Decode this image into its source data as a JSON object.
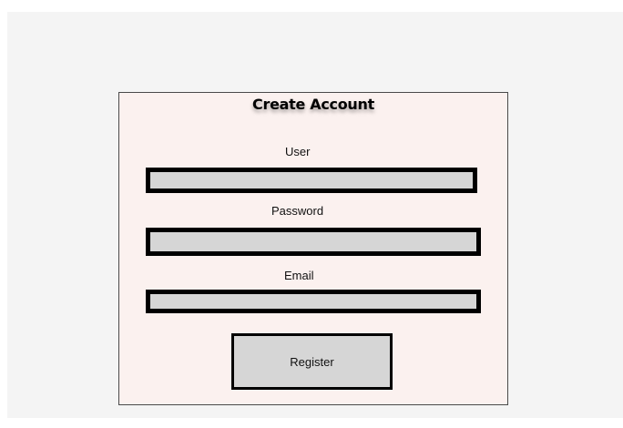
{
  "form": {
    "title": "Create Account",
    "user_label": "User",
    "user_value": "",
    "password_label": "Password",
    "password_value": "",
    "email_label": "Email",
    "email_value": "",
    "register_label": "Register"
  },
  "colors": {
    "page_background": "#f4f4f4",
    "card_background": "#fbf1ef",
    "field_fill": "#d6d6d6",
    "field_border": "#000000"
  }
}
